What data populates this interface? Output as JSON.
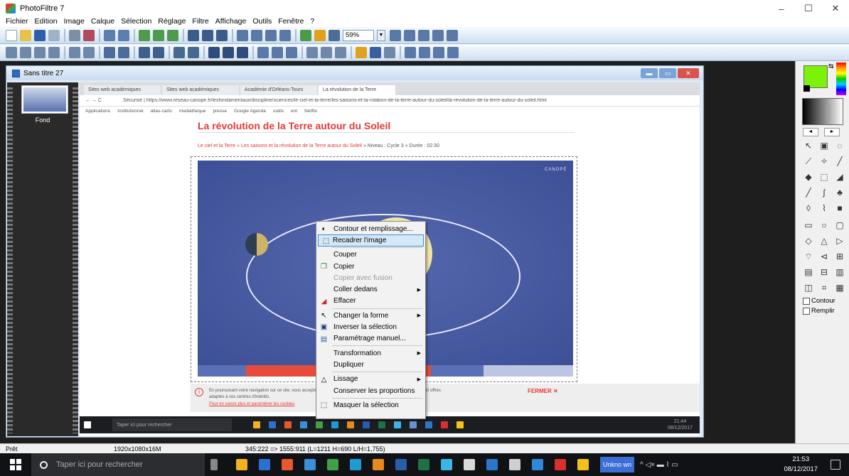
{
  "window": {
    "title": "PhotoFiltre 7",
    "minimize": "–",
    "maximize": "☐",
    "close": "✕"
  },
  "menu": [
    "Fichier",
    "Edition",
    "Image",
    "Calque",
    "Sélection",
    "Réglage",
    "Filtre",
    "Affichage",
    "Outils",
    "Fenêtre",
    "?"
  ],
  "toolbar": {
    "zoom_value": "59%"
  },
  "document": {
    "title": "Sans titre 27"
  },
  "layers": {
    "label": "Fond"
  },
  "browser": {
    "tabs": [
      "Sites web académiques",
      "Sites web académiques",
      "Académie d'Orléans-Tours",
      "La révolution de la Terre"
    ],
    "url": "Sécurisé | https://www.reseau-canope.fr/lesfondamentaux/discipline/sciences/le-ciel-et-la-terre/les-saisons-et-la-rotation-de-la-terre-autour-du-soleil/la-revolution-de-la-terre-autour-du-soleil.html",
    "bookmarks": [
      "Applications",
      "Institutionnel",
      "atlas-carto",
      "mediatheque",
      "presse",
      "Google Agenda",
      "outils",
      "ent",
      "Netflix"
    ]
  },
  "page": {
    "title": "La révolution de la Terre autour du Soleil",
    "meta": "Le ciel et la Terre » Les saisons et la révolution de la Terre autour du Soleil",
    "meta_level": " » Niveau : Cycle 3 » Durée : 02:30",
    "video_brand": "CANOPÉ",
    "cookie_line1": "En poursuivant votre navigation sur ce site, vous acceptez l'utilisation de cookies pour vous proposer des services et offres",
    "cookie_line2": "adaptés à vos centres d'intérêts.",
    "cookie_link": "Pour en savoir plus et paramétrer les cookies",
    "fermer": "FERMER ✕"
  },
  "inner_taskbar": {
    "search": "Taper ici pour rechercher",
    "time": "21:44",
    "date": "08/12/2017"
  },
  "context_menu": {
    "items": [
      {
        "label": "Contour et remplissage...",
        "icon": "contour-icon"
      },
      {
        "label": "Recadrer l'image",
        "icon": "crop-icon",
        "highlighted": true
      },
      {
        "separator": true
      },
      {
        "label": "Couper"
      },
      {
        "label": "Copier",
        "icon": "copy-icon"
      },
      {
        "label": "Copier avec fusion",
        "disabled": true
      },
      {
        "label": "Coller dedans",
        "submenu": true
      },
      {
        "label": "Effacer",
        "icon": "eraser-icon"
      },
      {
        "separator": true
      },
      {
        "label": "Changer la forme",
        "icon": "pointer-icon",
        "submenu": true
      },
      {
        "label": "Inverser la sélection",
        "icon": "invert-icon"
      },
      {
        "label": "Paramétrage manuel...",
        "icon": "settings-icon"
      },
      {
        "separator": true
      },
      {
        "label": "Transformation",
        "submenu": true
      },
      {
        "label": "Dupliquer"
      },
      {
        "separator": true
      },
      {
        "label": "Lissage",
        "icon": "smooth-icon",
        "submenu": true
      },
      {
        "label": "Conserver les proportions"
      },
      {
        "separator": true
      },
      {
        "label": "Masquer la sélection",
        "icon": "mask-icon"
      }
    ]
  },
  "palette": {
    "foreground": "#7cf10a",
    "contour": "Contour",
    "remplir": "Remplir"
  },
  "status": {
    "ready": "Prêt",
    "image_info": "1920x1080x16M",
    "selection_info": "345:222 => 1555:911 (L=1211 H=690 L/H=1,755)"
  },
  "taskbar": {
    "search": "Taper ici pour rechercher",
    "unknown": "Unkno wn",
    "time": "21:53",
    "date": "08/12/2017"
  }
}
